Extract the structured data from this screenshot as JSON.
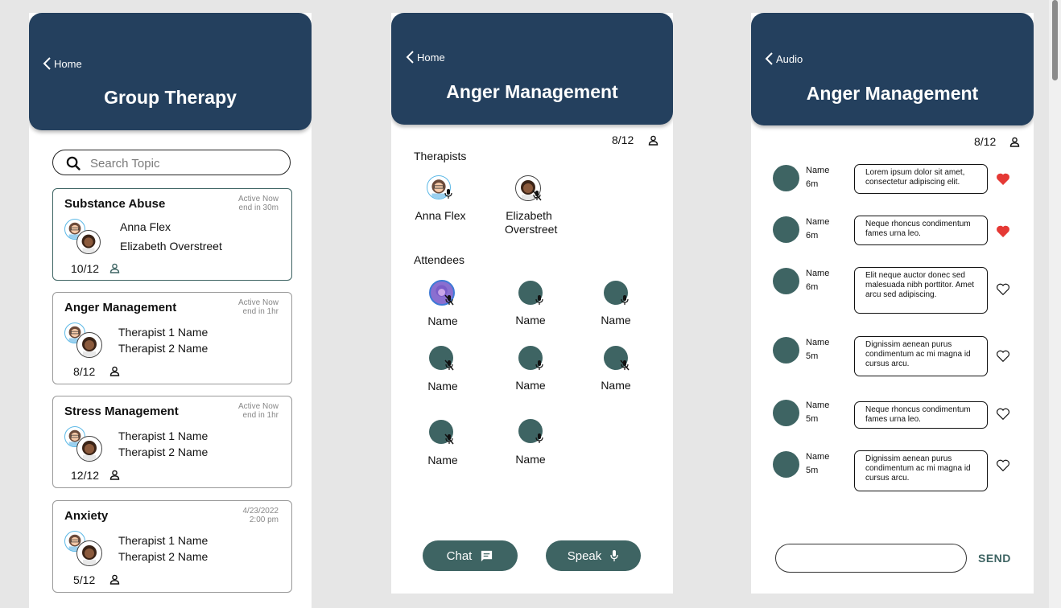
{
  "screen1": {
    "back": "Home",
    "title": "Group Therapy",
    "search_placeholder": "Search Topic",
    "cards": [
      {
        "title": "Substance Abuse",
        "status1": "Active Now",
        "status2": "end in 30m",
        "t1": "Anna Flex",
        "t2": "Elizabeth Overstreet",
        "count": "10/12"
      },
      {
        "title": "Anger Management",
        "status1": "Active Now",
        "status2": "end in 1hr",
        "t1": "Therapist 1 Name",
        "t2": "Therapist 2 Name",
        "count": "8/12"
      },
      {
        "title": "Stress Management",
        "status1": "Active Now",
        "status2": "end in 1hr",
        "t1": "Therapist 1 Name",
        "t2": "Therapist 2 Name",
        "count": "12/12"
      },
      {
        "title": "Anxiety",
        "status1": "4/23/2022",
        "status2": "2:00 pm",
        "t1": "Therapist 1 Name",
        "t2": "Therapist 2 Name",
        "count": "5/12"
      }
    ]
  },
  "screen2": {
    "back": "Home",
    "title": "Anger Management",
    "count": "8/12",
    "therapists_label": "Therapists",
    "therapists": [
      "Anna Flex",
      "Elizabeth Overstreet"
    ],
    "attendees_label": "Attendees",
    "attendees": [
      "Name",
      "Name",
      "Name",
      "Name",
      "Name",
      "Name",
      "Name",
      "Name"
    ],
    "chat_label": "Chat",
    "speak_label": "Speak"
  },
  "screen3": {
    "back": "Audio",
    "title": "Anger Management",
    "count": "8/12",
    "messages": [
      {
        "name": "Name",
        "time": "6m",
        "text": "Lorem ipsum dolor sit amet, consectetur adipiscing elit.",
        "liked": true
      },
      {
        "name": "Name",
        "time": "6m",
        "text": "Neque rhoncus condimentum fames urna leo.",
        "liked": true
      },
      {
        "name": "Name",
        "time": "6m",
        "text": "Elit neque auctor donec sed malesuada nibh porttitor. Amet arcu sed adipiscing.",
        "liked": false
      },
      {
        "name": "Name",
        "time": "5m",
        "text": "Dignissim aenean purus condimentum ac mi magna id cursus arcu.",
        "liked": false
      },
      {
        "name": "Name",
        "time": "5m",
        "text": "Neque rhoncus condimentum fames urna leo.",
        "liked": false
      },
      {
        "name": "Name",
        "time": "5m",
        "text": "Dignissim aenean purus condimentum ac mi magna id cursus arcu.",
        "liked": false
      }
    ],
    "send_label": "SEND"
  },
  "colors": {
    "header": "#24405e",
    "accent": "#3e6463",
    "heart": "#e53935"
  },
  "icons": [
    "chevron-left-icon",
    "search-icon",
    "person-icon",
    "mic-icon",
    "mic-off-icon",
    "chat-icon",
    "heart-icon"
  ]
}
